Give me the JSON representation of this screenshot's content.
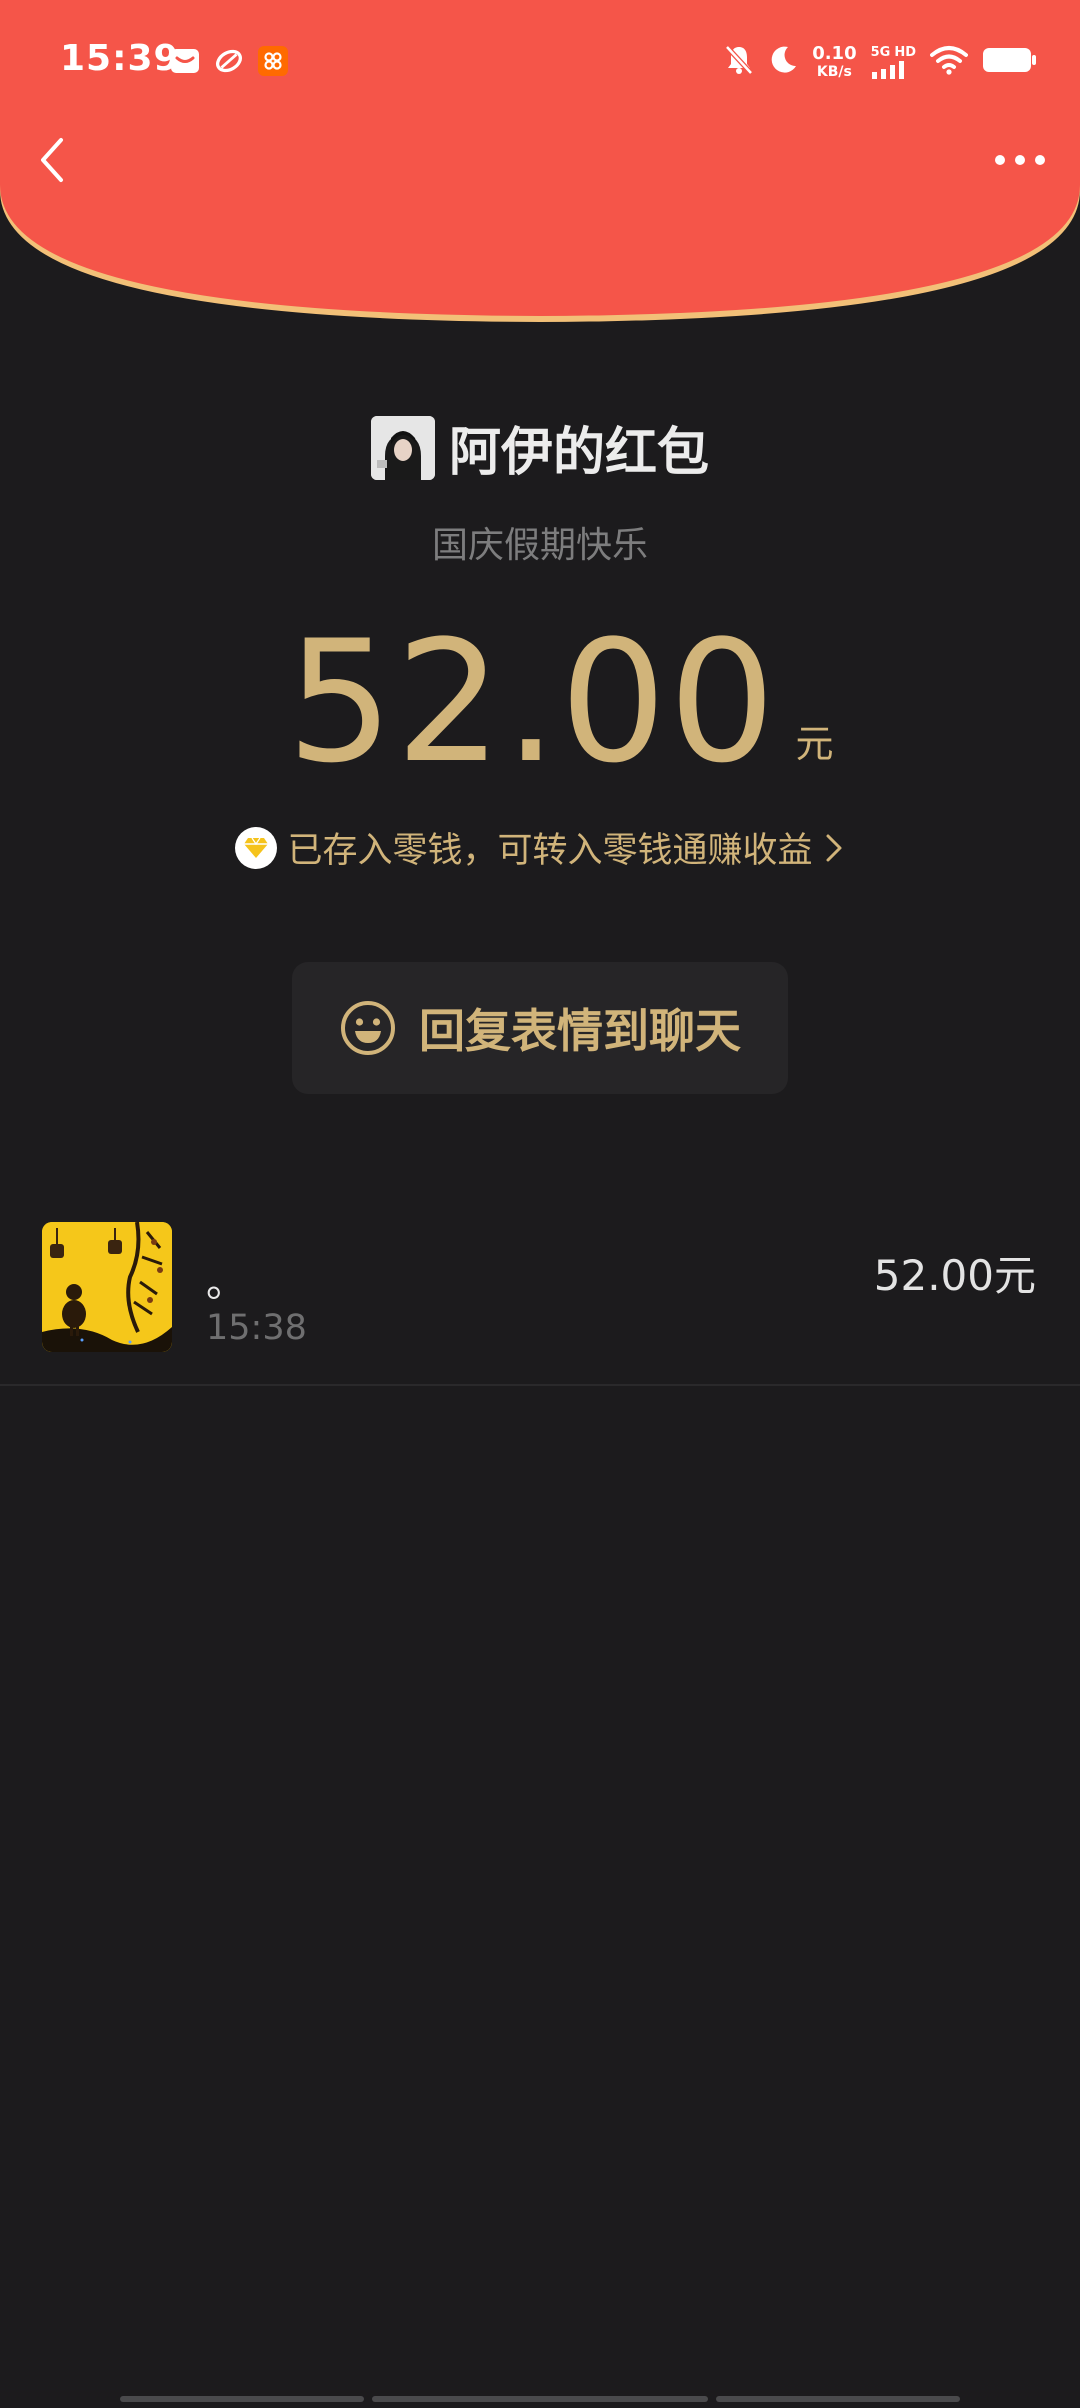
{
  "status_bar": {
    "time": "15:39",
    "net_speed_value": "0.10",
    "net_speed_unit": "KB/s",
    "network_type": "5G",
    "network_hd": "HD",
    "left_icons": [
      "mail-icon",
      "sports-app-icon",
      "taobao-app-icon"
    ],
    "right_icons": [
      "mute-bell-icon",
      "moon-icon",
      "signal-icon",
      "wifi-icon",
      "battery-icon"
    ]
  },
  "nav": {
    "back_icon": "chevron-left-icon",
    "more_icon": "more-dots-icon"
  },
  "sender": {
    "name": "阿伊的红包",
    "greeting": "国庆假期快乐"
  },
  "amount": {
    "value": "52.00",
    "unit": "元"
  },
  "deposit": {
    "text": "已存入零钱，可转入零钱通赚收益"
  },
  "reply": {
    "label": "回复表情到聊天"
  },
  "records": [
    {
      "message": "。",
      "time": "15:38",
      "amount": "52.00元"
    }
  ],
  "colors": {
    "envelope_red": "#f55549",
    "envelope_edge": "#f2c078",
    "gold": "#d1b47a",
    "background": "#1c1b1d"
  }
}
